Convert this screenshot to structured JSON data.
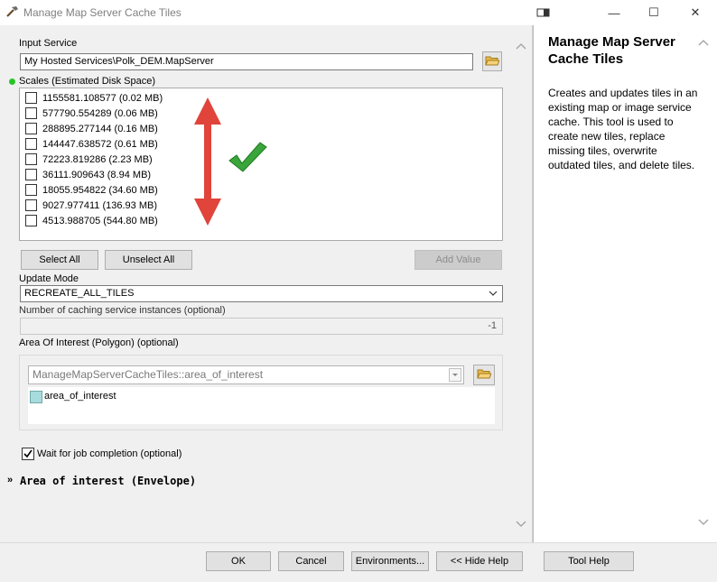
{
  "window": {
    "title": "Manage Map Server Cache Tiles",
    "controls": {
      "help_toggle_icon": "panel-icon",
      "minimize": "—",
      "maximize": "☐",
      "close": "✕"
    }
  },
  "form": {
    "input_service": {
      "label": "Input Service",
      "value": "My Hosted Services\\Polk_DEM.MapServer"
    },
    "scales": {
      "label": "Scales (Estimated Disk Space)",
      "items": [
        {
          "text": "1155581.108577 (0.02 MB)",
          "checked": false
        },
        {
          "text": "577790.554289 (0.06 MB)",
          "checked": false
        },
        {
          "text": "288895.277144 (0.16 MB)",
          "checked": false
        },
        {
          "text": "144447.638572 (0.61 MB)",
          "checked": false
        },
        {
          "text": "72223.819286 (2.23 MB)",
          "checked": false
        },
        {
          "text": "36111.909643 (8.94 MB)",
          "checked": false
        },
        {
          "text": "18055.954822 (34.60 MB)",
          "checked": false
        },
        {
          "text": "9027.977411 (136.93 MB)",
          "checked": false
        },
        {
          "text": "4513.988705 (544.80 MB)",
          "checked": false
        }
      ],
      "annotation_colors": {
        "arrow": "#e0443a",
        "check": "#3aa53a"
      }
    },
    "buttons": {
      "select_all": "Select All",
      "unselect_all": "Unselect All",
      "add_value": "Add Value"
    },
    "update_mode": {
      "label": "Update Mode",
      "value": "RECREATE_ALL_TILES"
    },
    "num_instances": {
      "label": "Number of caching service instances (optional)",
      "value": "-1"
    },
    "area_of_interest": {
      "label": "Area Of Interest (Polygon) (optional)",
      "selector_value": "ManageMapServerCacheTiles::area_of_interest",
      "feature_label": "area_of_interest",
      "feature_color": "#a8dcdc"
    },
    "wait_for_job": {
      "label": "Wait for job completion (optional)",
      "checked": true
    },
    "envelope_section": {
      "label": "Area of interest (Envelope)"
    }
  },
  "help": {
    "title": "Manage Map Server Cache Tiles",
    "body": "Creates and updates tiles in an existing map or image service cache. This tool is used to create new tiles, replace missing tiles, overwrite outdated tiles, and delete tiles."
  },
  "footer": {
    "ok": "OK",
    "cancel": "Cancel",
    "environments": "Environments...",
    "hide_help": "<< Hide Help",
    "tool_help": "Tool Help"
  }
}
